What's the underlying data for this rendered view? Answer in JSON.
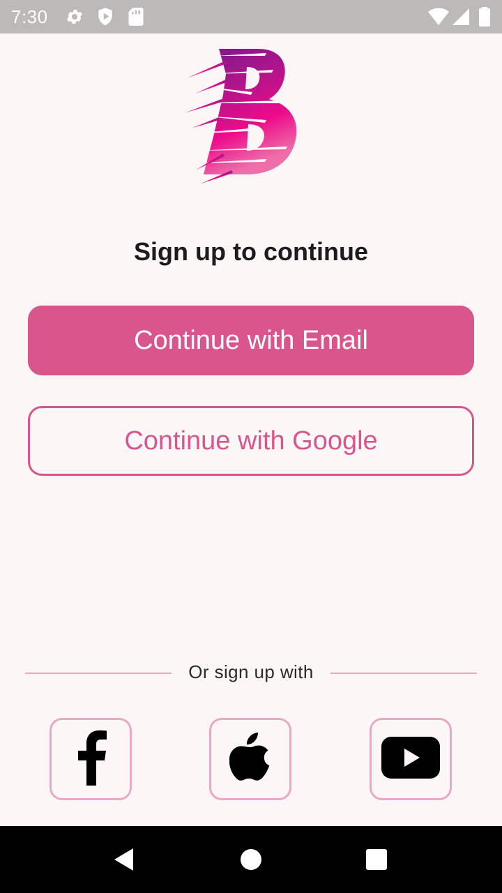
{
  "status_bar": {
    "time": "7:30",
    "left_icons": [
      "settings-icon",
      "shield-icon",
      "sd-card-icon"
    ],
    "right_icons": [
      "wifi-icon",
      "signal-icon",
      "battery-icon"
    ]
  },
  "logo": {
    "icon": "brand-b-logo",
    "colors": [
      "#7a1a8c",
      "#c0128a",
      "#ee0a8a",
      "#ee6fa8"
    ]
  },
  "title": "Sign up to continue",
  "buttons": {
    "email": "Continue with Email",
    "google": "Continue with Google"
  },
  "divider": {
    "text": "Or sign up with"
  },
  "social": [
    {
      "name": "Facebook",
      "icon": "facebook-icon"
    },
    {
      "name": "Apple",
      "icon": "apple-icon"
    },
    {
      "name": "YouTube",
      "icon": "youtube-icon"
    }
  ],
  "nav_bar": [
    "back-icon",
    "home-icon",
    "recents-icon"
  ],
  "colors": {
    "accent": "#d9568d",
    "accent_light": "#e8a9c4",
    "background": "#fdf6f6",
    "status_bar": "#bdb9b8"
  }
}
